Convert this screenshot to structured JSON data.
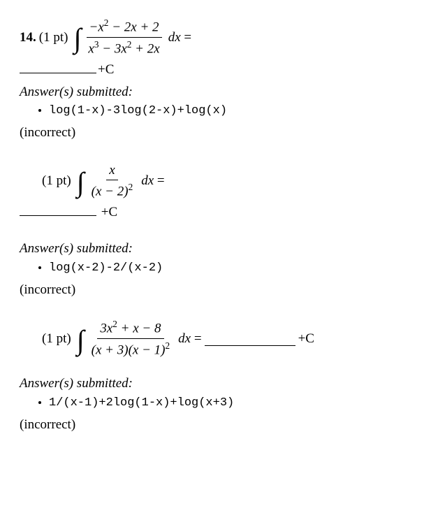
{
  "problems": [
    {
      "number": "14.",
      "points_label": "(1 pt)",
      "integral_numerator": "−x² − 2x + 2",
      "integral_denominator": "x³ − 3x² + 2x",
      "dx_equals": "dx =",
      "plus_c": "+C",
      "answers_label": "Answer(s) submitted:",
      "submitted": "log(1-x)-3log(2-x)+log(x)",
      "verdict": "(incorrect)",
      "layout": "below"
    },
    {
      "number": "",
      "points_label": "(1 pt)",
      "integral_numerator": "x",
      "integral_denominator": "(x − 2)²",
      "dx_equals": "dx =",
      "plus_c": "+C",
      "answers_label": "Answer(s) submitted:",
      "submitted": "log(x-2)-2/(x-2)",
      "verdict": "(incorrect)",
      "layout": "below"
    },
    {
      "number": "",
      "points_label": "(1 pt)",
      "integral_numerator": "3x² + x − 8",
      "integral_denominator": "(x + 3)(x − 1)²",
      "dx_equals": "dx =",
      "plus_c": "+C",
      "answers_label": "Answer(s) submitted:",
      "submitted": "1/(x-1)+2log(1-x)+log(x+3)",
      "verdict": "(incorrect)",
      "layout": "inline"
    }
  ]
}
